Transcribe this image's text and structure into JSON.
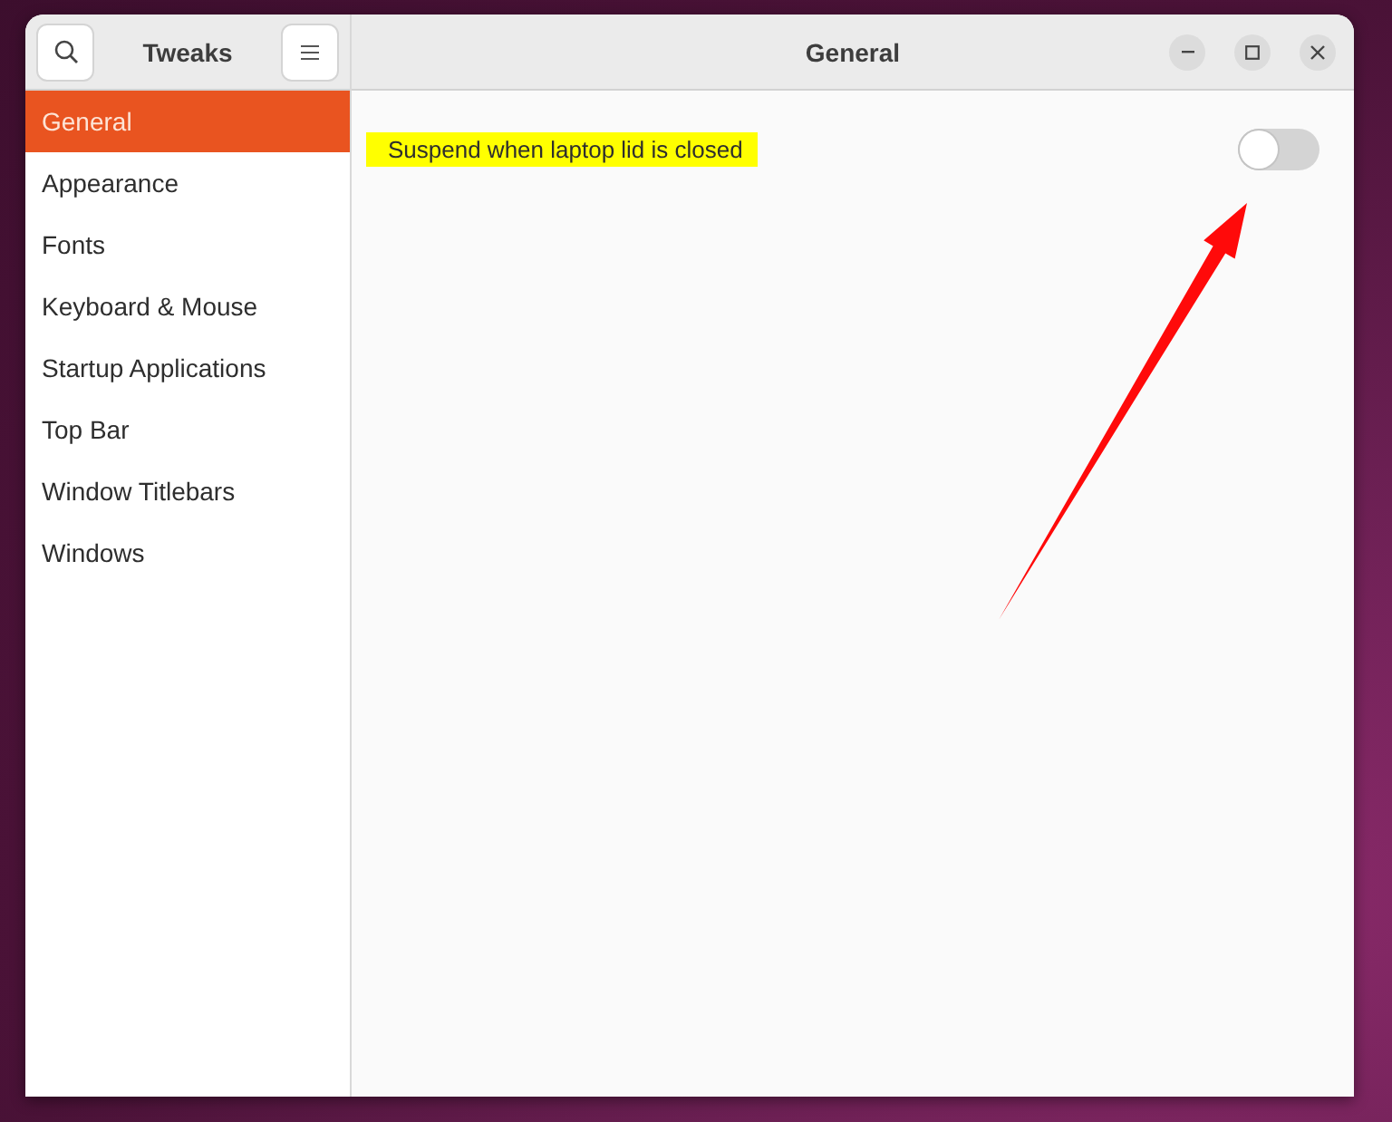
{
  "sidebar": {
    "title": "Tweaks",
    "items": [
      {
        "label": "General",
        "selected": true
      },
      {
        "label": "Appearance",
        "selected": false
      },
      {
        "label": "Fonts",
        "selected": false
      },
      {
        "label": "Keyboard & Mouse",
        "selected": false
      },
      {
        "label": "Startup Applications",
        "selected": false
      },
      {
        "label": "Top Bar",
        "selected": false
      },
      {
        "label": "Window Titlebars",
        "selected": false
      },
      {
        "label": "Windows",
        "selected": false
      }
    ]
  },
  "content": {
    "title": "General",
    "settings": [
      {
        "label": "Suspend when laptop lid is closed",
        "highlighted": true,
        "on": false
      }
    ]
  }
}
